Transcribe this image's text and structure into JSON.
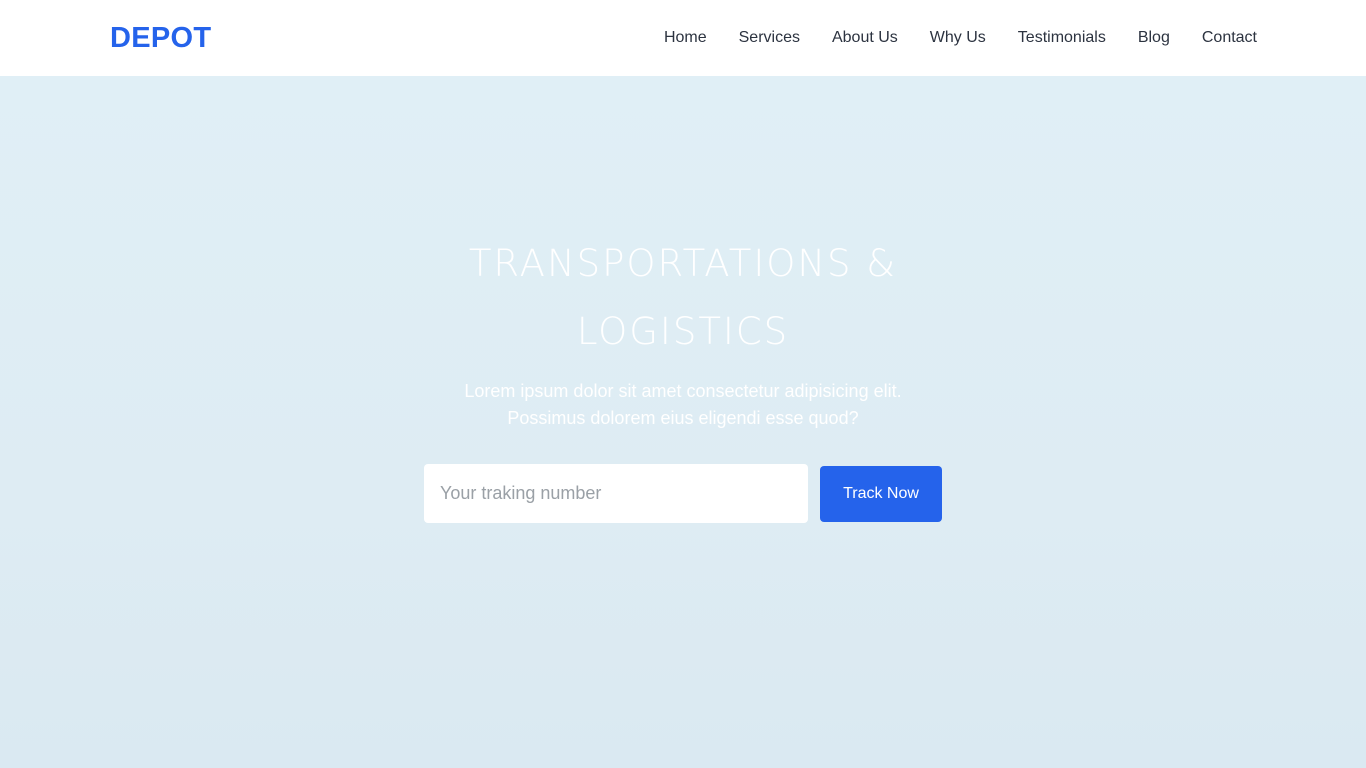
{
  "brand": {
    "name": "DEPOT",
    "color": "#2563eb"
  },
  "nav": {
    "items": [
      {
        "label": "Home"
      },
      {
        "label": "Services"
      },
      {
        "label": "About Us"
      },
      {
        "label": "Why Us"
      },
      {
        "label": "Testimonials"
      },
      {
        "label": "Blog"
      },
      {
        "label": "Contact"
      }
    ]
  },
  "hero": {
    "title": "TRANSPORTATIONS & LOGISTICS",
    "subtitle": "Lorem ipsum dolor sit amet consectetur adipisicing elit. Possimus dolorem eius eligendi esse quod?",
    "search": {
      "value": "",
      "placeholder": "Your traking number",
      "button_label": "Track Now"
    }
  },
  "colors": {
    "hero_background": "#deedf4",
    "button": "#2563eb",
    "nav_text": "#2c3340"
  }
}
